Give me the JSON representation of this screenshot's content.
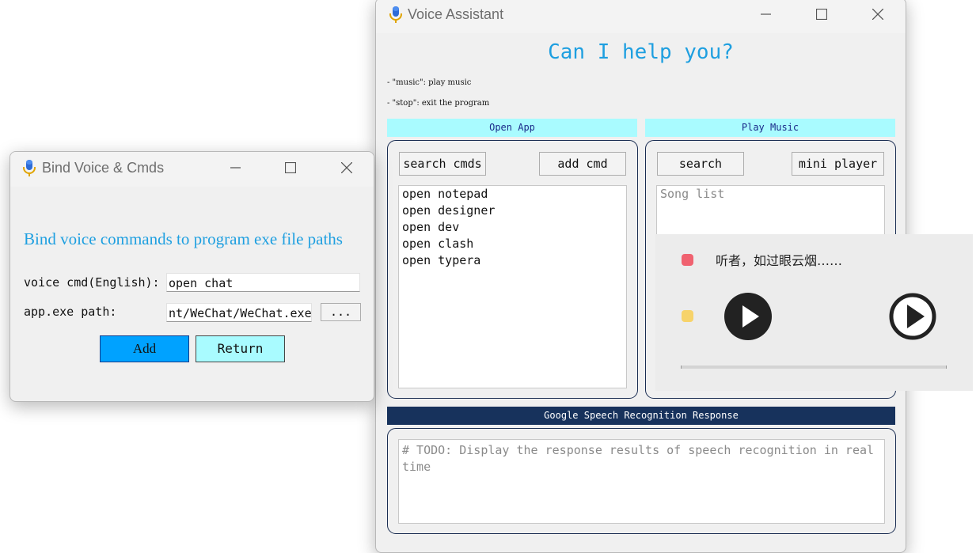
{
  "voice_assistant": {
    "title": "Voice Assistant",
    "headline": "Can I help you?",
    "hints": [
      "- \"music\": play music",
      "- \"stop\": exit the program"
    ],
    "open_app": {
      "header": "Open App",
      "search_label": "search cmds",
      "add_label": "add cmd",
      "items": [
        "open notepad",
        "open designer",
        "open dev",
        "open clash",
        "open typera"
      ]
    },
    "play_music": {
      "header": "Play Music",
      "search_label": "search",
      "mini_player_label": "mini player",
      "placeholder": "Song list"
    },
    "speech": {
      "header": "Google Speech Recognition Response",
      "placeholder": "# TODO: Display the response results of speech recognition in real time"
    }
  },
  "bind_window": {
    "title": "Bind Voice & Cmds",
    "heading": "Bind voice commands to program exe file paths",
    "voice_cmd_label": "voice cmd(English):",
    "voice_cmd_value": "open chat",
    "exe_path_label": "app.exe path:",
    "exe_path_value": "nt/WeChat/WeChat.exe",
    "browse_label": "...",
    "add_label": "Add",
    "return_label": "Return"
  },
  "mini_player": {
    "song_title": "听者，如过眼云烟……",
    "progress": 0
  },
  "colors": {
    "accent_blue": "#1e9fe0",
    "cyan_header": "#a9fbff",
    "navy_header": "#17325c",
    "add_button": "#00a2ff",
    "return_button": "#a9fbff",
    "red_dot": "#f06270",
    "yellow_dot": "#f7d36a"
  }
}
